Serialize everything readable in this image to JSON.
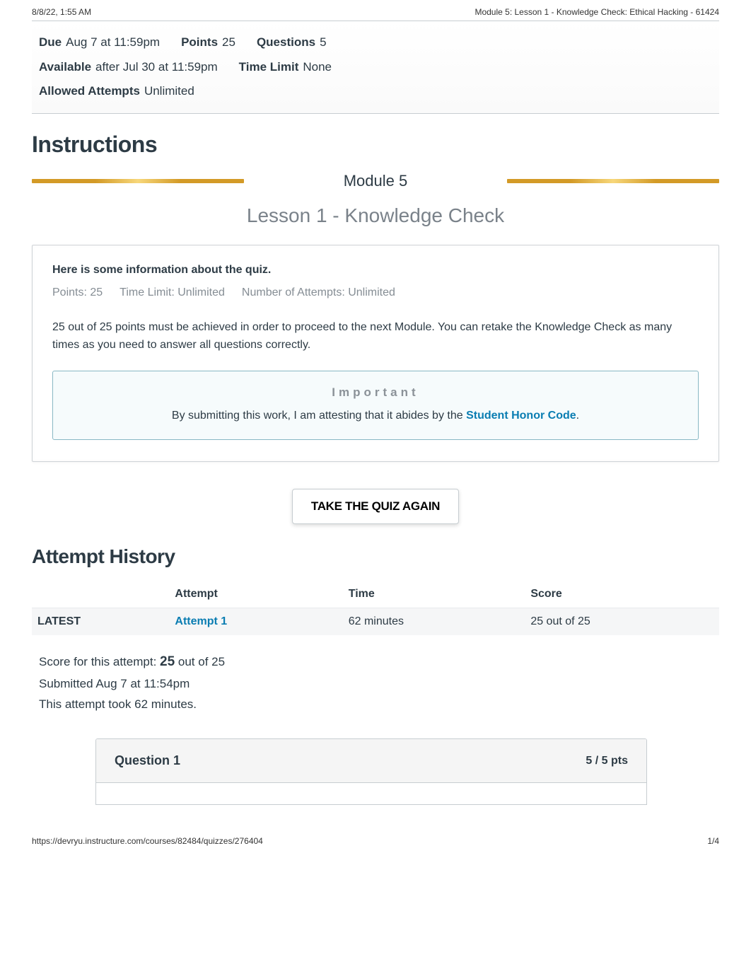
{
  "print_header": {
    "datetime": "8/8/22, 1:55 AM",
    "title": "Module 5: Lesson 1 - Knowledge Check: Ethical Hacking - 61424"
  },
  "summary": {
    "due": {
      "label": "Due",
      "value": "Aug 7 at 11:59pm"
    },
    "points": {
      "label": "Points",
      "value": "25"
    },
    "questions": {
      "label": "Questions",
      "value": "5"
    },
    "available": {
      "label": "Available",
      "value": "after Jul 30 at 11:59pm"
    },
    "timelimit": {
      "label": "Time Limit",
      "value": "None"
    },
    "attempts": {
      "label": "Allowed Attempts",
      "value": "Unlimited"
    }
  },
  "instructions": {
    "heading": "Instructions",
    "module": "Module 5",
    "lesson": "Lesson 1 - Knowledge Check",
    "card_heading": "Here is some information about the quiz.",
    "meta": {
      "points": "Points: 25",
      "timelimit": "Time Limit: Unlimited",
      "attempts": "Number of Attempts: Unlimited"
    },
    "description": "25 out of 25 points must be achieved in order to proceed to the next Module. You can retake the Knowledge Check as many times as you need to answer all questions correctly.",
    "important_title": "Important",
    "important_prefix": "By submitting this work, I am attesting that it abides by the ",
    "honor_link": "Student Honor Code",
    "important_suffix": "."
  },
  "take_button": "TAKE THE QUIZ AGAIN",
  "history": {
    "heading": "Attempt History",
    "columns": {
      "attempt": "Attempt",
      "time": "Time",
      "score": "Score"
    },
    "rows": [
      {
        "tag": "LATEST",
        "attempt_label": "Attempt 1",
        "time": "62 minutes",
        "score": "25 out of 25"
      }
    ]
  },
  "score_block": {
    "prefix": "Score for this attempt: ",
    "score_big": "25",
    "score_rest": " out of 25",
    "submitted": "Submitted Aug 7 at 11:54pm",
    "duration": "This attempt took 62 minutes."
  },
  "question": {
    "label": "Question 1",
    "pts": "5 / 5 pts"
  },
  "footer": {
    "url": "https://devryu.instructure.com/courses/82484/quizzes/276404",
    "page": "1/4"
  }
}
